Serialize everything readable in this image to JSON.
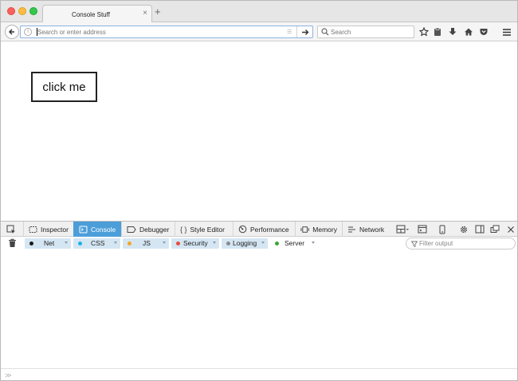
{
  "browser": {
    "tab": {
      "title": "Console Stuff",
      "close_label": "×"
    },
    "new_tab_label": "+",
    "nav": {
      "back_icon": "back-arrow-icon",
      "url_placeholder": "Search or enter address",
      "go_icon": "go-arrow-icon",
      "search_placeholder": "Search"
    },
    "toolbar_icons": [
      "star-icon",
      "clipboard-icon",
      "download-icon",
      "home-icon",
      "pocket-icon",
      "hamburger-menu-icon"
    ]
  },
  "page": {
    "button_label": "click me"
  },
  "devtools": {
    "tabs": [
      {
        "label": "Inspector",
        "icon": "inspector-icon",
        "active": false
      },
      {
        "label": "Console",
        "icon": "console-icon",
        "active": true
      },
      {
        "label": "Debugger",
        "icon": "debugger-icon",
        "active": false
      },
      {
        "label": "Style Editor",
        "icon": "braces-icon",
        "active": false
      },
      {
        "label": "Performance",
        "icon": "performance-icon",
        "active": false
      },
      {
        "label": "Memory",
        "icon": "memory-icon",
        "active": false
      },
      {
        "label": "Network",
        "icon": "network-icon",
        "active": false
      }
    ],
    "filters": [
      {
        "label": "Net",
        "color": "#1a1a1a"
      },
      {
        "label": "CSS",
        "color": "#1ab3e6"
      },
      {
        "label": "JS",
        "color": "#f5a623"
      },
      {
        "label": "Security",
        "color": "#e74c3c"
      },
      {
        "label": "Logging",
        "color": "#8a8a8a"
      },
      {
        "label": "Server",
        "color": "#3aa63a"
      }
    ],
    "filter_placeholder": "Filter output",
    "accent_color": "#4c9ed9"
  }
}
